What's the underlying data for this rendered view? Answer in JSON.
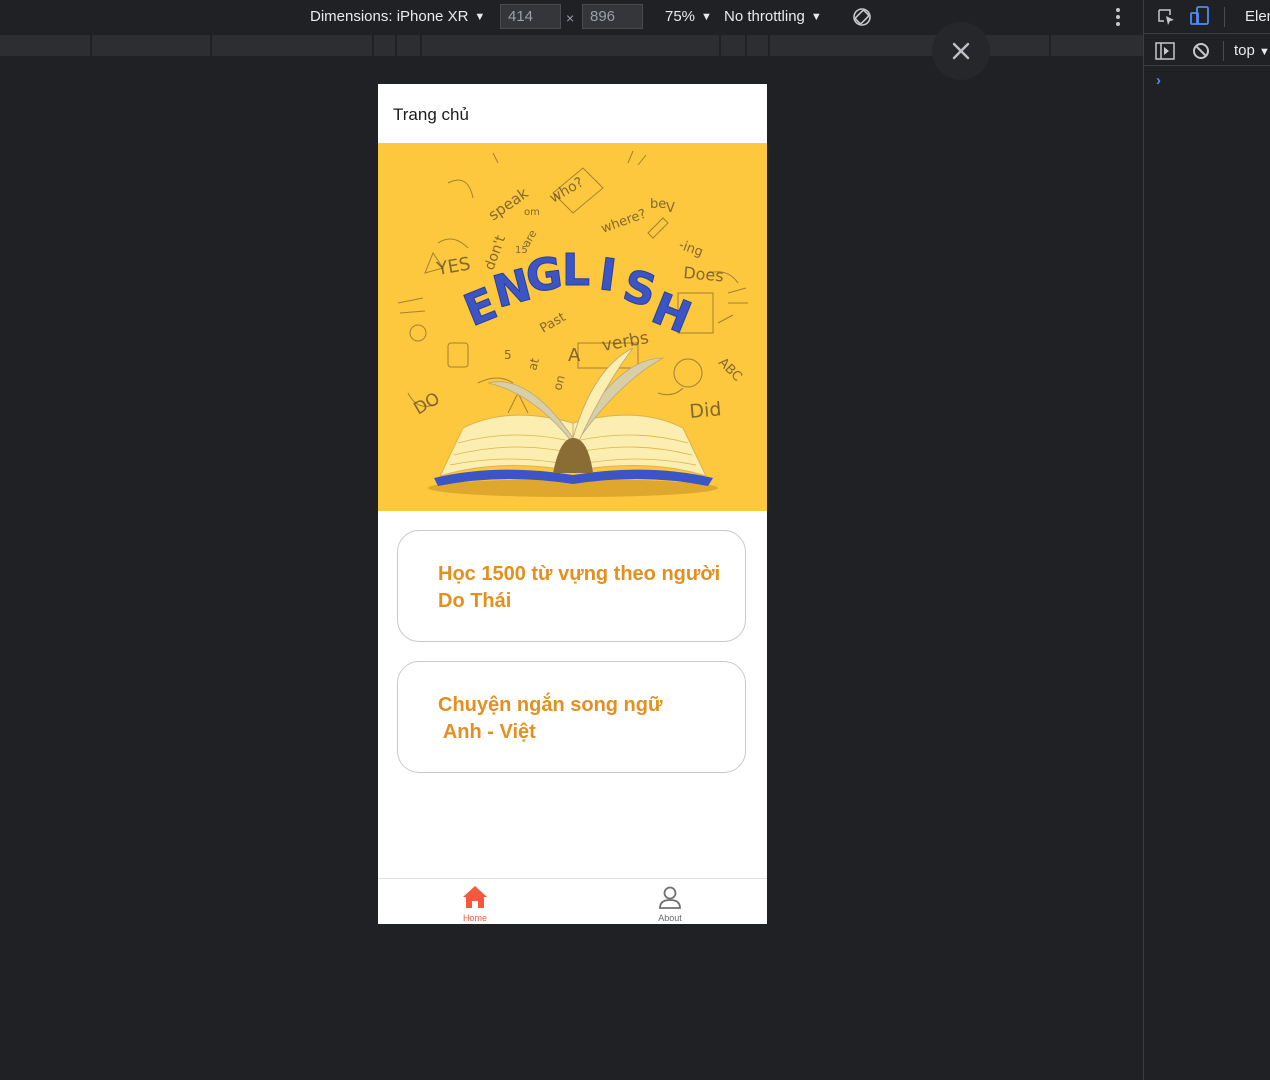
{
  "devtools": {
    "dimensions_label": "Dimensions: iPhone XR",
    "width_value": "414",
    "height_value": "896",
    "times_sign": "×",
    "zoom": "75%",
    "throttling": "No throttling",
    "elements_tab": "Elem",
    "context_select": "top",
    "console_prompt": "›"
  },
  "app": {
    "header_title": "Trang chủ",
    "banner": {
      "title_word": "ENGLISH",
      "doodle_words": [
        "speak",
        "who?",
        "where?",
        "-ing",
        "Does",
        "YES",
        "don't",
        "are",
        "Past",
        "verbs",
        "ABC",
        "Did",
        "DO",
        "at",
        "on",
        "A",
        "V",
        "5",
        "15",
        "om",
        "be"
      ]
    },
    "cards": [
      {
        "line1": "Học 1500 từ vựng theo người",
        "line2": "Do Thái"
      },
      {
        "line1": "Chuyện ngắn song ngữ",
        "line2": " Anh - Việt"
      }
    ],
    "tabs": [
      {
        "label": "Home",
        "icon": "home-icon",
        "active": true
      },
      {
        "label": "About",
        "icon": "user-icon",
        "active": false
      }
    ]
  },
  "colors": {
    "accent": "#e48f1f",
    "active_tab": "#f5593d",
    "banner_bg": "#fdc73e",
    "title_blue": "#3b55c7"
  }
}
